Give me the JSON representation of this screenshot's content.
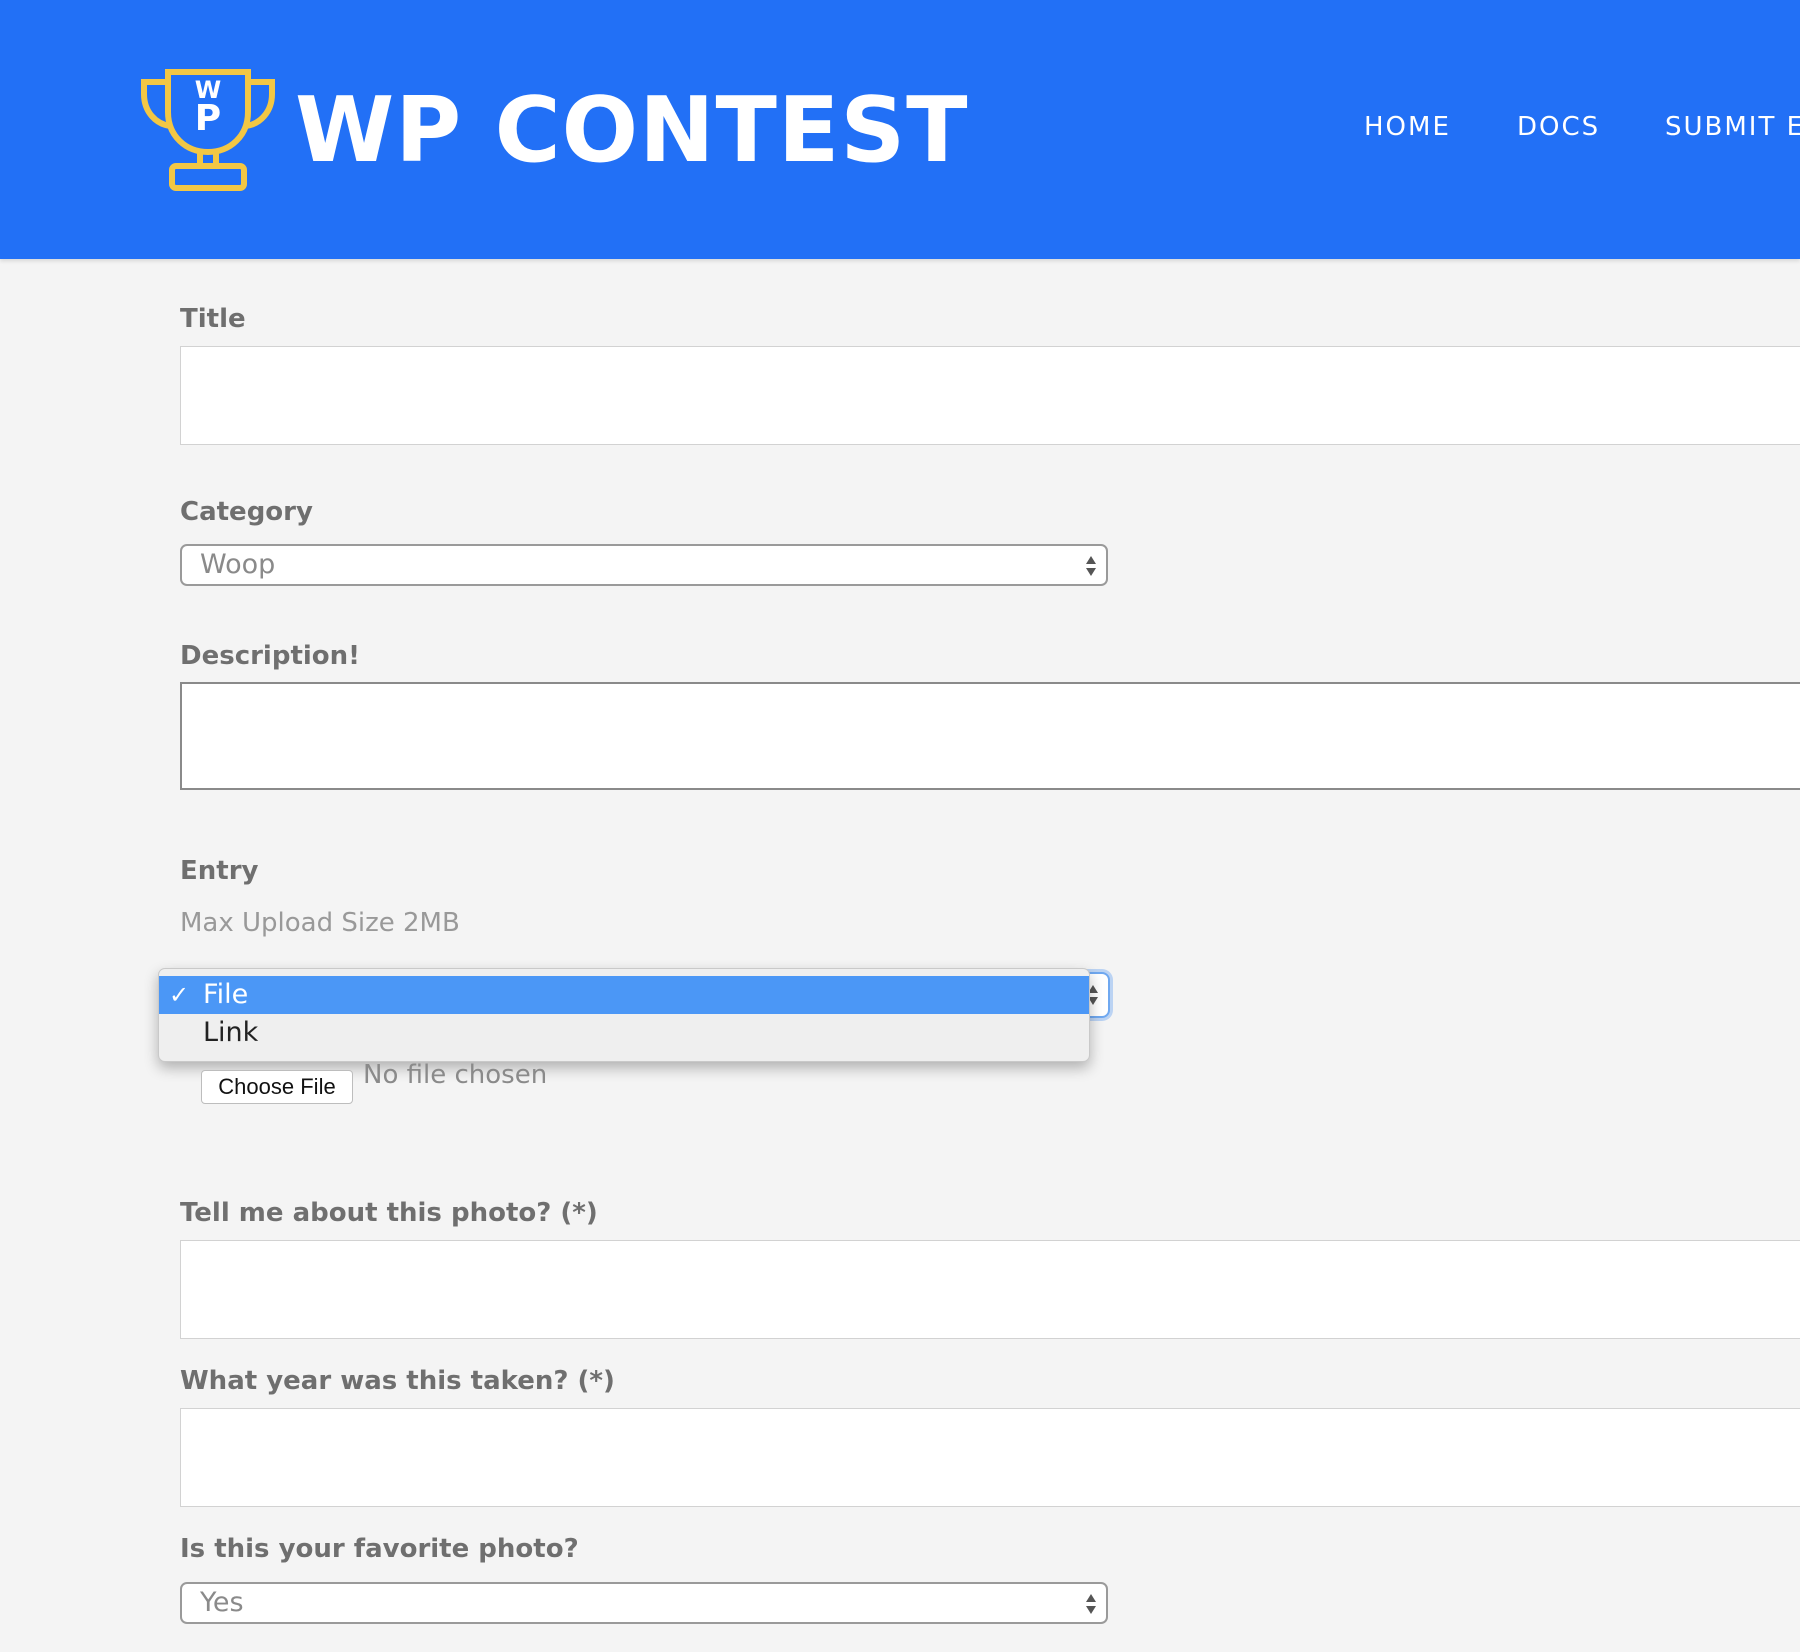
{
  "header": {
    "logo_text": "WP CONTEST",
    "nav": [
      "HOME",
      "DOCS",
      "SUBMIT E"
    ],
    "colors": {
      "background": "#2270f6",
      "logo_accent": "#f3c744"
    }
  },
  "form": {
    "title_label": "Title",
    "category_label": "Category",
    "category_value": "Woop",
    "description_label": "Description!",
    "entry_label": "Entry",
    "max_upload": "Max Upload Size 2MB",
    "entry_options": [
      "File",
      "Link"
    ],
    "entry_selected": "File",
    "choose_file": "Choose File",
    "no_file": "No file chosen",
    "photo_about_label": "Tell me about this photo? (*)",
    "year_label": "What year was this taken? (*)",
    "favorite_label": "Is this your favorite photo?",
    "favorite_value": "Yes"
  }
}
